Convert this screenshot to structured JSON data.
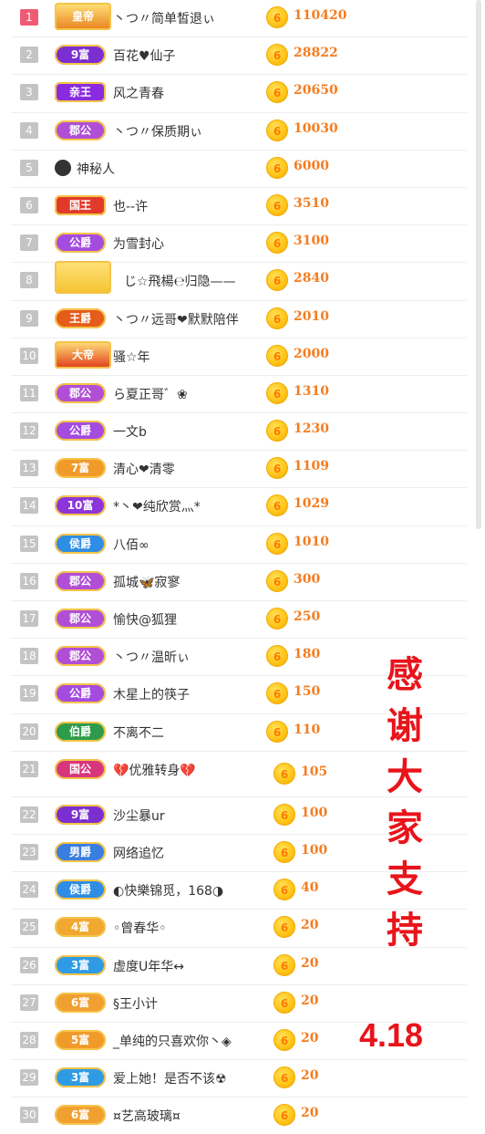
{
  "rows": [
    {
      "rank": "1",
      "badge": "皇帝",
      "name": "丶つ〃简单皙退ぃ",
      "amount": "110420",
      "badge_color": "#e8821e",
      "style": "crown"
    },
    {
      "rank": "2",
      "badge": "9富",
      "name": "百花♥仙子",
      "amount": "28822",
      "badge_color": "#7b2fd1",
      "style": "pill"
    },
    {
      "rank": "3",
      "badge": "亲王",
      "name": "风之青春",
      "amount": "20650",
      "badge_color": "#8a2be2",
      "style": "big"
    },
    {
      "rank": "4",
      "badge": "郡公",
      "name": "丶つ〃保质期ぃ",
      "amount": "10030",
      "badge_color": "#b04fd6",
      "style": "pill"
    },
    {
      "rank": "5",
      "badge": "",
      "name": "神秘人",
      "amount": "6000",
      "badge_color": "",
      "style": "mystery"
    },
    {
      "rank": "6",
      "badge": "国王",
      "name": "也--许",
      "amount": "3510",
      "badge_color": "#e23a2a",
      "style": "big"
    },
    {
      "rank": "7",
      "badge": "公爵",
      "name": "为雪封心",
      "amount": "3100",
      "badge_color": "#a44be0",
      "style": "pill"
    },
    {
      "rank": "8",
      "badge": "",
      "name": "じ☆飛楊℮归隐——",
      "amount": "2840",
      "badge_color": "#f4c330",
      "style": "crown"
    },
    {
      "rank": "9",
      "badge": "王爵",
      "name": "丶つ〃远哥❤默默陪伴",
      "amount": "2010",
      "badge_color": "#e55c1b",
      "style": "pill"
    },
    {
      "rank": "10",
      "badge": "大帝",
      "name": "骚☆年",
      "amount": "2000",
      "badge_color": "#e03a1a",
      "style": "crown"
    },
    {
      "rank": "11",
      "badge": "郡公",
      "name": "ら夏正哥゛❀",
      "amount": "1310",
      "badge_color": "#b04fd6",
      "style": "pill"
    },
    {
      "rank": "12",
      "badge": "公爵",
      "name": "一文b",
      "amount": "1230",
      "badge_color": "#a44be0",
      "style": "pill"
    },
    {
      "rank": "13",
      "badge": "7富",
      "name": "清心❤清零",
      "amount": "1109",
      "badge_color": "#f09a2a",
      "style": "pill"
    },
    {
      "rank": "14",
      "badge": "10富",
      "name": "*丶❤纯欣赏灬*",
      "amount": "1029",
      "badge_color": "#8c35d8",
      "style": "pill"
    },
    {
      "rank": "15",
      "badge": "侯爵",
      "name": "八佰∞",
      "amount": "1010",
      "badge_color": "#2f8de4",
      "style": "pill"
    },
    {
      "rank": "16",
      "badge": "郡公",
      "name": "孤城🦋寂寥",
      "amount": "300",
      "badge_color": "#b04fd6",
      "style": "pill"
    },
    {
      "rank": "17",
      "badge": "郡公",
      "name": "愉快@狐狸",
      "amount": "250",
      "badge_color": "#b04fd6",
      "style": "pill"
    },
    {
      "rank": "18",
      "badge": "郡公",
      "name": "丶つ〃温昕ぃ",
      "amount": "180",
      "badge_color": "#b04fd6",
      "style": "pill"
    },
    {
      "rank": "19",
      "badge": "公爵",
      "name": "木星上的筷子",
      "amount": "150",
      "badge_color": "#a44be0",
      "style": "pill"
    },
    {
      "rank": "20",
      "badge": "伯爵",
      "name": "不离不二",
      "amount": "110",
      "badge_color": "#2e9b4a",
      "style": "pill"
    },
    {
      "rank": "21",
      "badge": "国公",
      "name": "💔优雅转身💔",
      "amount": "105",
      "badge_color": "#d8367c",
      "style": "pill"
    },
    {
      "rank": "22",
      "badge": "9富",
      "name": "沙尘暴ur",
      "amount": "100",
      "badge_color": "#7b2fd1",
      "style": "pill"
    },
    {
      "rank": "23",
      "badge": "男爵",
      "name": "网络追忆",
      "amount": "100",
      "badge_color": "#3a7ee0",
      "style": "pill"
    },
    {
      "rank": "24",
      "badge": "侯爵",
      "name": "◐快樂锦觅，168◑",
      "amount": "40",
      "badge_color": "#2f8de4",
      "style": "pill"
    },
    {
      "rank": "25",
      "badge": "4富",
      "name": "◦曾春华◦",
      "amount": "20",
      "badge_color": "#f0a830",
      "style": "pill"
    },
    {
      "rank": "26",
      "badge": "3富",
      "name": "虚度U年华↔",
      "amount": "20",
      "badge_color": "#2f9be4",
      "style": "pill"
    },
    {
      "rank": "27",
      "badge": "6富",
      "name": "§王小计",
      "amount": "20",
      "badge_color": "#f0a030",
      "style": "pill"
    },
    {
      "rank": "28",
      "badge": "5富",
      "name": "_单纯的只喜欢你丶◈",
      "amount": "20",
      "badge_color": "#f09a2a",
      "style": "pill"
    },
    {
      "rank": "29",
      "badge": "3富",
      "name": "爱上她！是否不该☢",
      "amount": "20",
      "badge_color": "#2f9be4",
      "style": "pill"
    },
    {
      "rank": "30",
      "badge": "6富",
      "name": "¤艺高玻璃¤",
      "amount": "20",
      "badge_color": "#f0a030",
      "style": "pill"
    }
  ],
  "coin_symbol": "6",
  "thanks_text": "感谢大家支持",
  "date_text": "4.18",
  "accent_color": "#e8141a"
}
